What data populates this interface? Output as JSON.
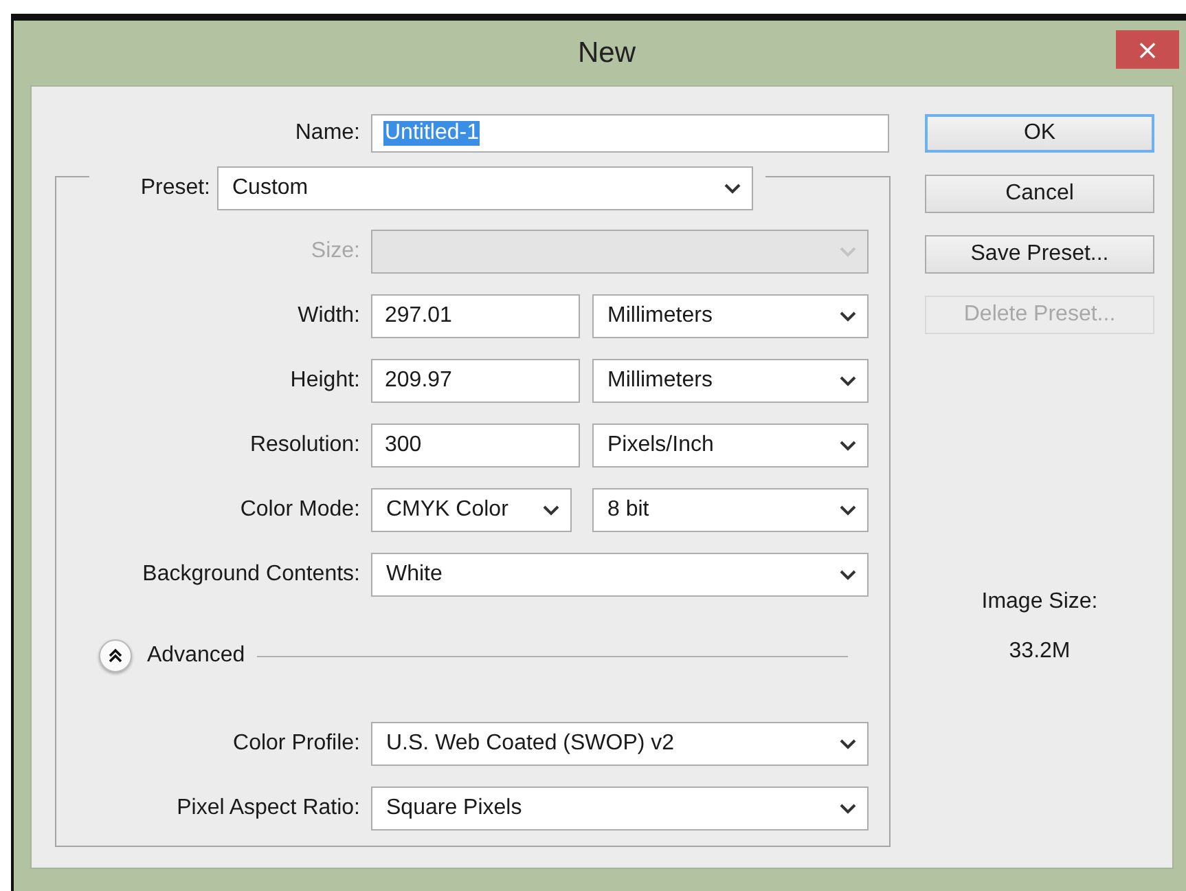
{
  "window": {
    "title": "New",
    "close": "×"
  },
  "name": {
    "label": "Name:",
    "value": "Untitled-1",
    "text_selected": true
  },
  "preset": {
    "label": "Preset:",
    "value": "Custom"
  },
  "rows": [
    {
      "kind": "select",
      "label": "Size:",
      "disabled": true
    },
    {
      "kind": "field_select",
      "label": "Width:",
      "value": "297.01",
      "unit": "Millimeters",
      "disabled": false
    },
    {
      "kind": "field_select",
      "label": "Height:",
      "value": "209.97",
      "unit": "Millimeters",
      "disabled": false
    },
    {
      "kind": "field_select",
      "label": "Resolution:",
      "value": "300",
      "unit": "Pixels/Inch",
      "disabled": false
    },
    {
      "kind": "dual_select",
      "label": "Color Mode:",
      "value": "CMYK Color",
      "unit": "8 bit",
      "disabled": false
    },
    {
      "kind": "select",
      "label": "Background Contents:",
      "value": "White",
      "disabled": false
    }
  ],
  "advanced": {
    "label": "Advanced",
    "expanded": true,
    "rows": [
      {
        "kind": "select",
        "label": "Color Profile:",
        "value": "U.S. Web Coated (SWOP) v2",
        "disabled": false
      },
      {
        "kind": "select",
        "label": "Pixel Aspect Ratio:",
        "value": "Square Pixels",
        "disabled": false
      }
    ]
  },
  "buttons": [
    {
      "label": "OK",
      "focused": true,
      "disabled": false
    },
    {
      "label": "Cancel",
      "focused": false,
      "disabled": false
    },
    {
      "label": "Save Preset...",
      "focused": false,
      "disabled": false
    },
    {
      "label": "Delete Preset...",
      "focused": false,
      "disabled": true
    }
  ],
  "image_size": {
    "label": "Image Size:",
    "value": "33.2M"
  }
}
